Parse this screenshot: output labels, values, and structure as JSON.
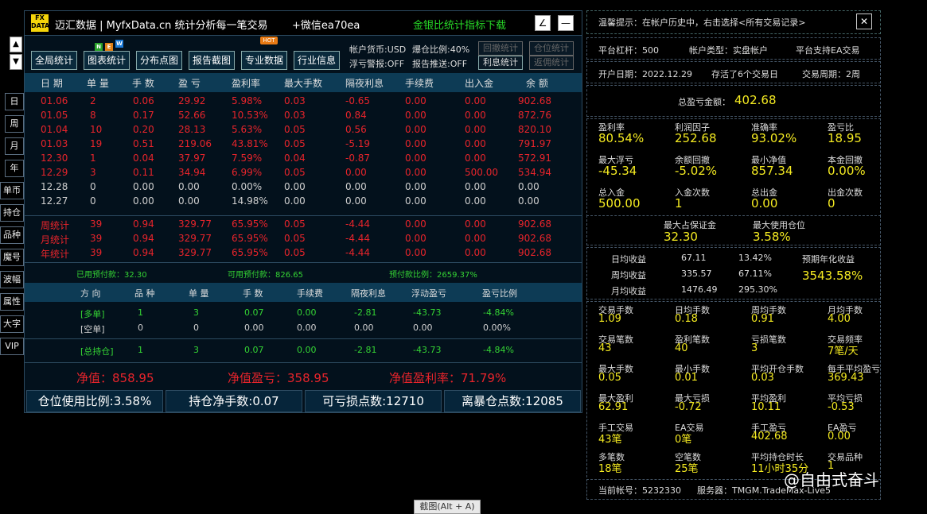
{
  "side": {
    "arrows": [
      "▲",
      "▼"
    ],
    "period_buttons": [
      "日",
      "周",
      "月",
      "年"
    ],
    "menu_buttons": [
      "单币",
      "持仓",
      "品种",
      "魔号",
      "波幅",
      "属性",
      "大字",
      "VIP"
    ]
  },
  "title": {
    "logo_top": "FX",
    "logo_bottom": "DATA",
    "app": "迈汇数据 | MyfxData.cn  统计分析每一笔交易",
    "wechat": "+微信ea70ea",
    "promo": "金银比统计指标下载",
    "edit_icon": "∠",
    "min_icon": "—"
  },
  "toolbar": {
    "buttons": [
      "全局统计",
      "图表统计",
      "分布点图",
      "报告截图",
      "专业数据",
      "行业信息"
    ],
    "new_badge": [
      "N",
      "E",
      "W"
    ],
    "hot_badge": "HOT",
    "account_currency": "帐户货币:USD",
    "margin_ratio": "爆仓比例:40%",
    "float_alert": "浮亏警报:OFF",
    "report_push": "报告推送:OFF",
    "btn_drawdown": "回撤统计",
    "btn_position": "仓位统计",
    "btn_interest": "利息统计",
    "btn_rebate": "返佣统计"
  },
  "table": {
    "headers": [
      "日 期",
      "单 量",
      "手 数",
      "盈 亏",
      "盈利率",
      "最大手数",
      "隔夜利息",
      "手续费",
      "出入金",
      "余 额"
    ],
    "rows": [
      [
        "01.06",
        "2",
        "0.06",
        "29.92",
        "5.98%",
        "0.03",
        "-0.65",
        "0.00",
        "0.00",
        "902.68"
      ],
      [
        "01.05",
        "8",
        "0.17",
        "52.66",
        "10.53%",
        "0.03",
        "0.84",
        "0.00",
        "0.00",
        "872.76"
      ],
      [
        "01.04",
        "10",
        "0.20",
        "28.13",
        "5.63%",
        "0.05",
        "0.56",
        "0.00",
        "0.00",
        "820.10"
      ],
      [
        "01.03",
        "19",
        "0.51",
        "219.06",
        "43.81%",
        "0.05",
        "-5.19",
        "0.00",
        "0.00",
        "791.97"
      ],
      [
        "12.30",
        "1",
        "0.04",
        "37.97",
        "7.59%",
        "0.04",
        "-0.87",
        "0.00",
        "0.00",
        "572.91"
      ],
      [
        "12.29",
        "3",
        "0.11",
        "34.94",
        "6.99%",
        "0.05",
        "0.00",
        "0.00",
        "500.00",
        "534.94"
      ],
      [
        "12.28",
        "0",
        "0.00",
        "0.00",
        "0.00%",
        "0.00",
        "0.00",
        "0.00",
        "0.00",
        "0.00"
      ],
      [
        "12.27",
        "0",
        "0.00",
        "0.00",
        "14.98%",
        "0.00",
        "0.00",
        "0.00",
        "0.00",
        "0.00"
      ]
    ],
    "totals": [
      [
        "周统计",
        "39",
        "0.94",
        "329.77",
        "65.95%",
        "0.05",
        "-4.44",
        "0.00",
        "0.00",
        "902.68"
      ],
      [
        "月统计",
        "39",
        "0.94",
        "329.77",
        "65.95%",
        "0.05",
        "-4.44",
        "0.00",
        "0.00",
        "902.68"
      ],
      [
        "年统计",
        "39",
        "0.94",
        "329.77",
        "65.95%",
        "0.05",
        "-4.44",
        "0.00",
        "0.00",
        "902.68"
      ]
    ]
  },
  "prepay": {
    "used": "已用预付款：32.30",
    "available": "可用预付款：826.65",
    "ratio": "预付款比例：2659.37%"
  },
  "positions": {
    "headers": [
      "方 向",
      "品 种",
      "单 量",
      "手 数",
      "手续费",
      "隔夜利息",
      "浮动盈亏",
      "盈亏比例"
    ],
    "rows": [
      [
        "[多单]",
        "1",
        "3",
        "0.07",
        "0.00",
        "-2.81",
        "-43.73",
        "-4.84%"
      ],
      [
        "[空单]",
        "0",
        "0",
        "0.00",
        "0.00",
        "0.00",
        "0.00",
        "0.00%"
      ]
    ],
    "total": [
      "[总持仓]",
      "1",
      "3",
      "0.07",
      "0.00",
      "-2.81",
      "-43.73",
      "-4.84%"
    ]
  },
  "equity": {
    "net": "净值：858.95",
    "net_pl": "净值盈亏：358.95",
    "net_rate": "净值盈利率：71.79%"
  },
  "status": [
    "仓位使用比例:3.58%",
    "持仓净手数:0.07",
    "可亏损点数:12710",
    "离暴仓点数:12085"
  ],
  "right": {
    "notice": "温馨提示：在帐户历史中，右击选择<所有交易记录>",
    "close_icon": "✕",
    "leverage": "平台杠杆：500",
    "account_type": "帐户类型：实盘帐户",
    "ea_support": "平台支持EA交易",
    "open_date": "开户日期：2022.12.29",
    "days": "存活了6个交易日",
    "cycle": "交易周期：2周",
    "total_pl_label": "总盈亏金额：",
    "total_pl": "402.68",
    "grid1": [
      [
        "盈利率",
        "80.54%"
      ],
      [
        "利润因子",
        "252.68"
      ],
      [
        "准确率",
        "93.02%"
      ],
      [
        "盈亏比",
        "18.95"
      ],
      [
        "最大浮亏",
        "-45.34"
      ],
      [
        "余额回撤",
        "-5.02%"
      ],
      [
        "最小净值",
        "857.34"
      ],
      [
        "本金回撤",
        "0.00%"
      ],
      [
        "总入金",
        "500.00"
      ],
      [
        "入金次数",
        "1"
      ],
      [
        "总出金",
        "0.00"
      ],
      [
        "出金次数",
        "0"
      ]
    ],
    "margin_max_label": "最大占保证金",
    "margin_max": "32.30",
    "pos_max_label": "最大使用仓位",
    "pos_max": "3.58%",
    "returns": [
      [
        "日均收益",
        "67.11",
        "13.42%"
      ],
      [
        "周均收益",
        "335.57",
        "67.11%"
      ],
      [
        "月均收益",
        "1476.49",
        "295.30%"
      ]
    ],
    "annual_label": "预期年化收益",
    "annual": "3543.58%",
    "grid2": [
      [
        "交易手数",
        "1.09"
      ],
      [
        "日均手数",
        "0.18"
      ],
      [
        "周均手数",
        "0.91"
      ],
      [
        "月均手数",
        "4.00"
      ],
      [
        "交易笔数",
        "43"
      ],
      [
        "盈利笔数",
        "40"
      ],
      [
        "亏损笔数",
        "3"
      ],
      [
        "交易频率",
        "7笔/天"
      ],
      [
        "最大手数",
        "0.05"
      ],
      [
        "最小手数",
        "0.01"
      ],
      [
        "平均开仓手数",
        "0.03"
      ],
      [
        "每手平均盈亏",
        "369.43"
      ],
      [
        "最大盈利",
        "62.91"
      ],
      [
        "最大亏损",
        "-0.72"
      ],
      [
        "平均盈利",
        "10.11"
      ],
      [
        "平均亏损",
        "-0.53"
      ],
      [
        "手工交易",
        "43笔"
      ],
      [
        "EA交易",
        "0笔"
      ],
      [
        "手工盈亏",
        "402.68"
      ],
      [
        "EA盈亏",
        "0.00"
      ],
      [
        "多笔数",
        "18笔"
      ],
      [
        "空笔数",
        "25笔"
      ],
      [
        "平均持仓时长",
        "11小时35分"
      ],
      [
        "交易品种",
        "1"
      ]
    ],
    "account_no": "当前帐号：5232330",
    "server": "服务器：TMGM.TradeMax-Live5"
  },
  "tooltip": "截图(Alt + A)",
  "watermark": "@自由式奋斗"
}
